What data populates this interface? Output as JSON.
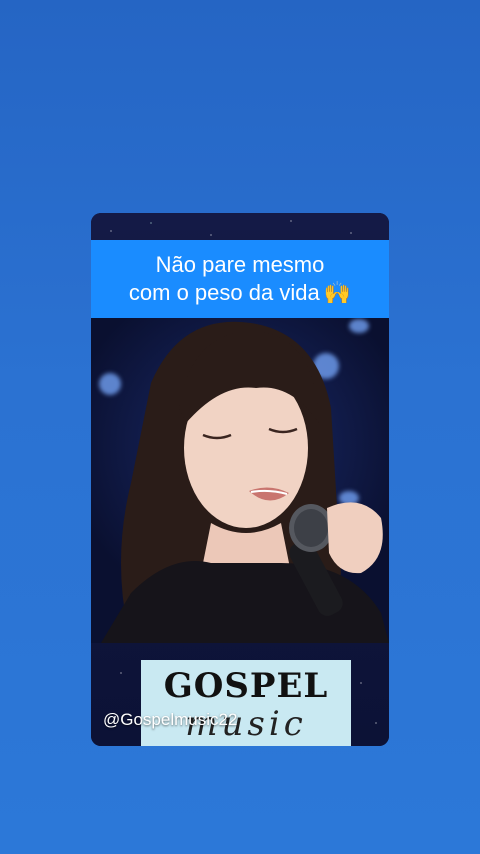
{
  "caption": {
    "line1": "Não pare mesmo",
    "line2": "com o peso da vida",
    "emoji": "🙌"
  },
  "banner": {
    "title": "GOSPEL",
    "script": "music"
  },
  "handle": "@Gospelmusic22",
  "colors": {
    "background": "#2b72d2",
    "caption_bg": "#1a8cff",
    "banner_bg": "#c9e9f2"
  }
}
